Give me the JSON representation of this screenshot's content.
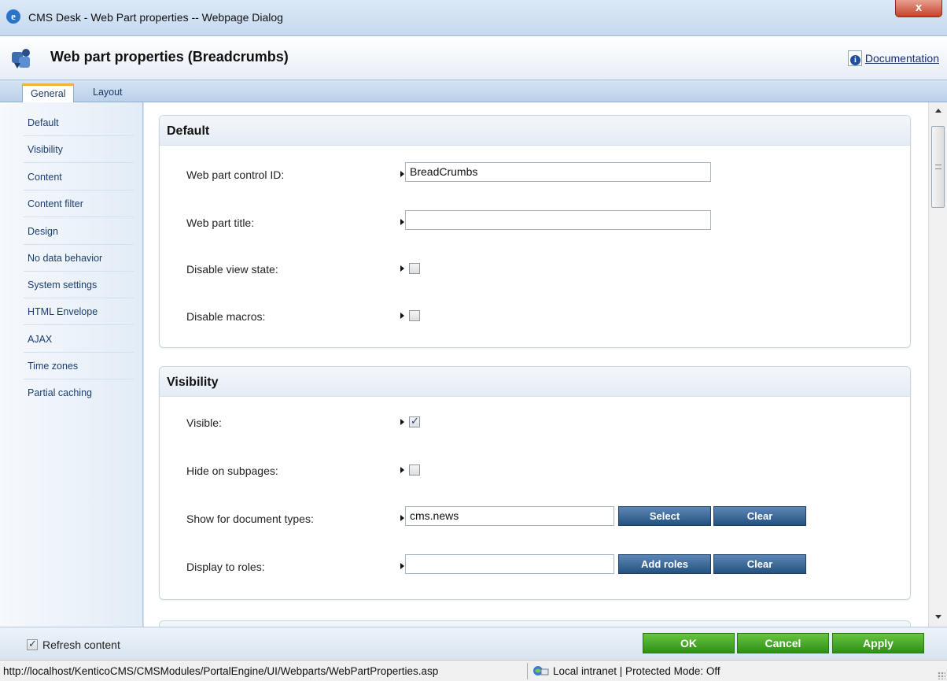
{
  "window": {
    "title": "CMS Desk - Web Part properties -- Webpage Dialog",
    "close_label": "x"
  },
  "header": {
    "title": "Web part properties (Breadcrumbs)",
    "documentation_label": "Documentation"
  },
  "tabs": [
    {
      "label": "General",
      "active": true
    },
    {
      "label": "Layout",
      "active": false
    }
  ],
  "sidebar": {
    "items": [
      {
        "label": "Default"
      },
      {
        "label": "Visibility"
      },
      {
        "label": "Content"
      },
      {
        "label": "Content filter"
      },
      {
        "label": "Design"
      },
      {
        "label": "No data behavior"
      },
      {
        "label": "System settings"
      },
      {
        "label": "HTML Envelope"
      },
      {
        "label": "AJAX"
      },
      {
        "label": "Time zones"
      },
      {
        "label": "Partial caching"
      }
    ]
  },
  "sections": {
    "default": {
      "title": "Default",
      "control_id_label": "Web part control ID:",
      "control_id_value": "BreadCrumbs",
      "title_label": "Web part title:",
      "title_value": "",
      "disable_viewstate_label": "Disable view state:",
      "disable_viewstate_checked": false,
      "disable_macros_label": "Disable macros:",
      "disable_macros_checked": false
    },
    "visibility": {
      "title": "Visibility",
      "visible_label": "Visible:",
      "visible_checked": true,
      "hide_subpages_label": "Hide on subpages:",
      "hide_subpages_checked": false,
      "doc_types_label": "Show for document types:",
      "doc_types_value": "cms.news",
      "select_label": "Select",
      "clear_label": "Clear",
      "roles_label": "Display to roles:",
      "roles_value": "",
      "add_roles_label": "Add roles",
      "roles_clear_label": "Clear"
    }
  },
  "footer": {
    "refresh_label": "Refresh content",
    "refresh_checked": true,
    "ok_label": "OK",
    "cancel_label": "Cancel",
    "apply_label": "Apply"
  },
  "statusbar": {
    "url": "http://localhost/KenticoCMS/CMSModules/PortalEngine/UI/Webparts/WebPartProperties.asp",
    "zone": "Local intranet | Protected Mode: Off"
  },
  "colors": {
    "accent_tab": "#f2b33d",
    "blue_button": "#2f5f8f",
    "green_button": "#3fa32a",
    "close_button": "#c4412a"
  }
}
